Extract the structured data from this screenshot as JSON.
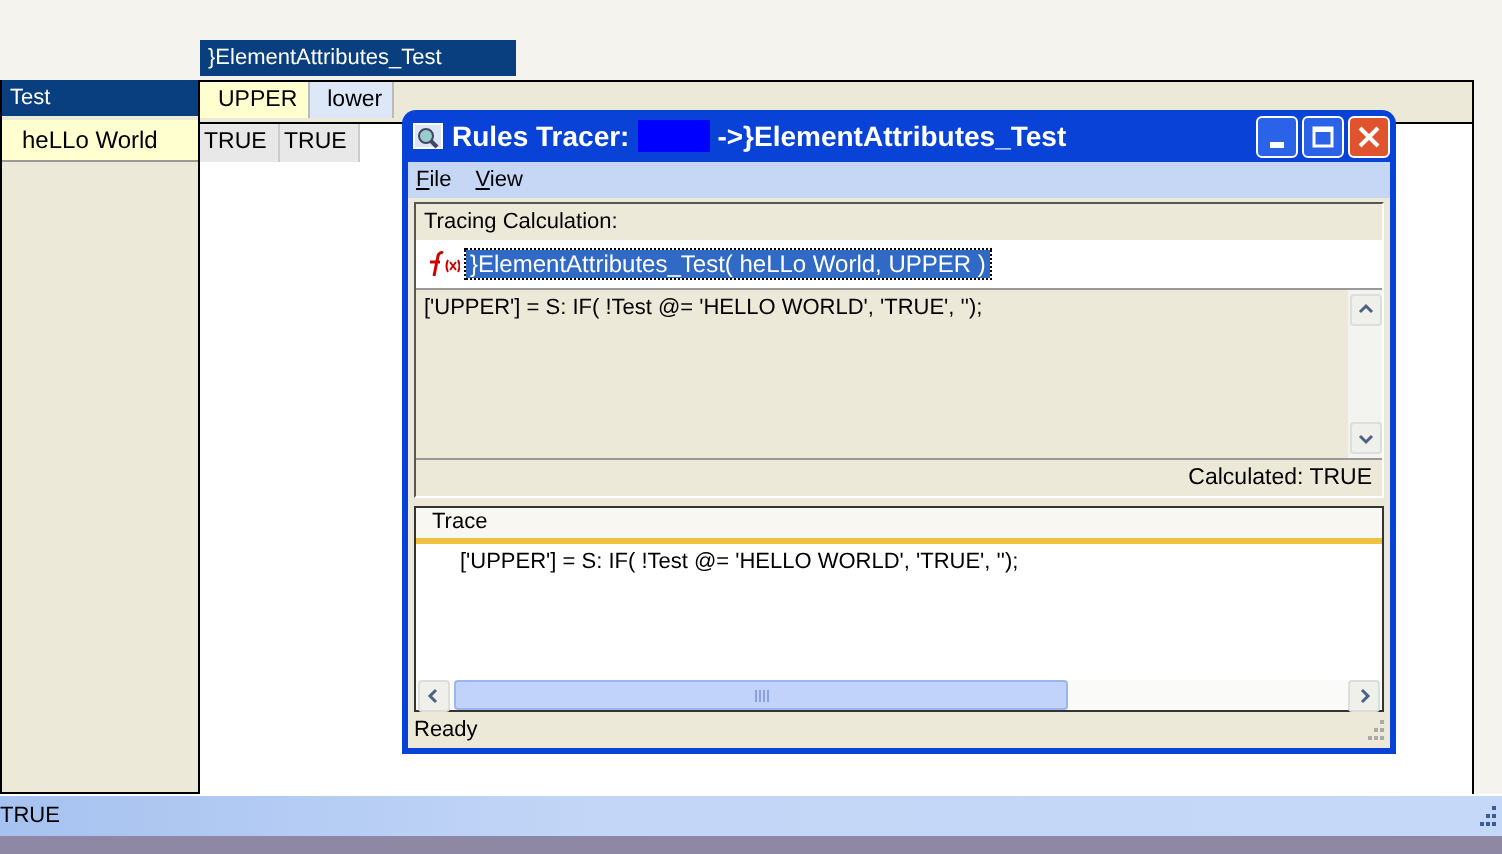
{
  "cube_view": {
    "title": "}ElementAttributes_Test",
    "row_header": "Test",
    "columns": [
      {
        "label": "UPPER",
        "color": "#ffffd0"
      },
      {
        "label": "lower",
        "color": "#dce8f8"
      }
    ],
    "rows": [
      {
        "label": "heLLo World",
        "cells": [
          "TRUE",
          "TRUE"
        ]
      }
    ]
  },
  "status_bar": {
    "text": "TRUE"
  },
  "dialog": {
    "title_prefix": "Rules Tracer:",
    "title_suffix": "->}ElementAttributes_Test",
    "menu": [
      "File",
      "View"
    ],
    "tracing_label": "Tracing Calculation:",
    "calculation": "}ElementAttributes_Test( heLLo World, UPPER )",
    "rule": "['UPPER'] = S: IF( !Test @= 'HELLO WORLD', 'TRUE', '');",
    "calculated": "Calculated: TRUE",
    "trace_header": "Trace",
    "trace_lines": [
      "['UPPER'] = S: IF( !Test @= 'HELLO WORLD', 'TRUE', '');"
    ],
    "status": "Ready"
  }
}
